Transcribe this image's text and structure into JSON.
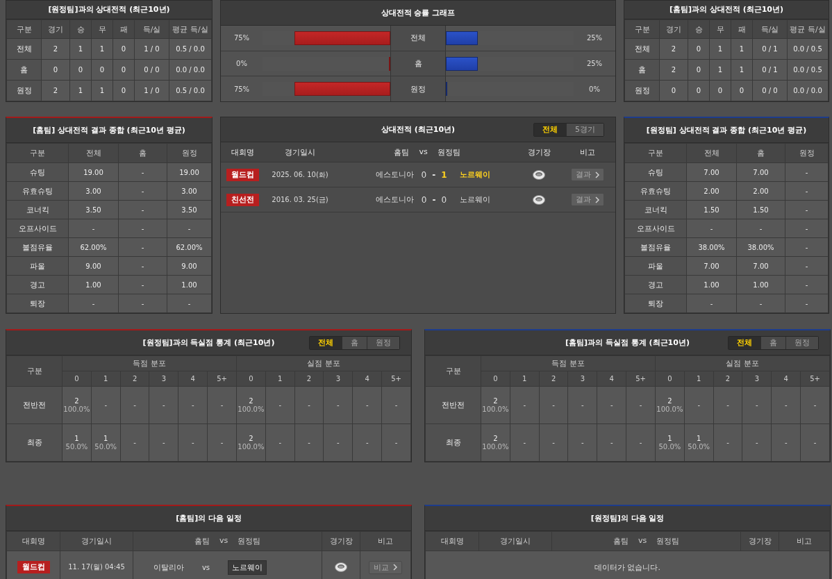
{
  "record_left": {
    "title": "[원정팀]과의 상대전적 (최근10년)",
    "columns": [
      "구분",
      "경기",
      "승",
      "무",
      "패",
      "득/실",
      "평균 득/실"
    ],
    "rows": [
      [
        "전체",
        "2",
        "1",
        "1",
        "0",
        "1 / 0",
        "0.5 / 0.0"
      ],
      [
        "홈",
        "0",
        "0",
        "0",
        "0",
        "0 / 0",
        "0.0 / 0.0"
      ],
      [
        "원정",
        "2",
        "1",
        "1",
        "0",
        "1 / 0",
        "0.5 / 0.0"
      ]
    ]
  },
  "win_graph": {
    "title": "상대전적 승률 그래프",
    "rows": [
      {
        "label": "전체",
        "home": {
          "reading": "75%",
          "level": 0.75
        },
        "away": {
          "reading": "25%",
          "level": 0.25
        }
      },
      {
        "label": "홈",
        "home": {
          "reading": "0%",
          "level": 0
        },
        "away": {
          "reading": "25%",
          "level": 0.25
        }
      },
      {
        "label": "원정",
        "home": {
          "reading": "75%",
          "level": 0.75
        },
        "away": {
          "reading": "0%",
          "level": 0
        }
      }
    ]
  },
  "record_right": {
    "title": "[홈팀]과의 상대전적 (최근10년)",
    "columns": [
      "구분",
      "경기",
      "승",
      "무",
      "패",
      "득/실",
      "평균 득/실"
    ],
    "rows": [
      [
        "전체",
        "2",
        "0",
        "1",
        "1",
        "0 / 1",
        "0.0 / 0.5"
      ],
      [
        "홈",
        "2",
        "0",
        "1",
        "1",
        "0 / 1",
        "0.0 / 0.5"
      ],
      [
        "원정",
        "0",
        "0",
        "0",
        "0",
        "0 / 0",
        "0.0 / 0.0"
      ]
    ]
  },
  "summary_home": {
    "home_side": true,
    "title": "[홈팀] 상대전적 결과 종합 (최근10년 평균)",
    "columns": [
      "구분",
      "전체",
      "홈",
      "원정"
    ],
    "rows": [
      [
        "슈팅",
        "19.00",
        "-",
        "19.00"
      ],
      [
        "유효슈팅",
        "3.00",
        "-",
        "3.00"
      ],
      [
        "코너킥",
        "3.50",
        "-",
        "3.50"
      ],
      [
        "오프사이드",
        "-",
        "-",
        "-"
      ],
      [
        "볼점유율",
        "62.00%",
        "-",
        "62.00%"
      ],
      [
        "파울",
        "9.00",
        "-",
        "9.00"
      ],
      [
        "경고",
        "1.00",
        "-",
        "1.00"
      ],
      [
        "퇴장",
        "-",
        "-",
        "-"
      ]
    ]
  },
  "head_to_head": {
    "title": "상대전적 (최근10년)",
    "tabs": [
      {
        "label": "전체",
        "selected": true
      },
      {
        "label": "5경기",
        "selected": false
      }
    ],
    "columns": [
      "대회명",
      "경기일시",
      "홈팀",
      "vs",
      "원정팀",
      "경기장",
      "비고"
    ],
    "rows": [
      {
        "competition": "월드컵",
        "color": "#b71f1f",
        "date": "2025. 06. 10(화)",
        "home": "에스토니아",
        "home_score": "0",
        "separator": "-",
        "away_score": "1",
        "away": "노르웨이",
        "home_won": false,
        "away_won": true,
        "button": "결과"
      },
      {
        "competition": "친선전",
        "color": "#b71f1f",
        "date": "2016. 03. 25(금)",
        "home": "에스토니아",
        "home_score": "0",
        "separator": "-",
        "away_score": "0",
        "away": "노르웨이",
        "home_won": false,
        "away_won": false,
        "button": "결과"
      }
    ]
  },
  "summary_away": {
    "home_side": false,
    "title": "[원정팀] 상대전적 결과 종합 (최근10년 평균)",
    "columns": [
      "구분",
      "전체",
      "홈",
      "원정"
    ],
    "rows": [
      [
        "슈팅",
        "7.00",
        "7.00",
        "-"
      ],
      [
        "유효슈팅",
        "2.00",
        "2.00",
        "-"
      ],
      [
        "코너킥",
        "1.50",
        "1.50",
        "-"
      ],
      [
        "오프사이드",
        "-",
        "-",
        "-"
      ],
      [
        "볼점유율",
        "38.00%",
        "38.00%",
        "-"
      ],
      [
        "파울",
        "7.00",
        "7.00",
        "-"
      ],
      [
        "경고",
        "1.00",
        "1.00",
        "-"
      ],
      [
        "퇴장",
        "-",
        "-",
        "-"
      ]
    ]
  },
  "goals_home": {
    "home_side": true,
    "title": "[원정팀]과의 득실점 통계 (최근10년)",
    "tabs": [
      {
        "label": "전체",
        "selected": true
      },
      {
        "label": "홈",
        "selected": false
      },
      {
        "label": "원정",
        "selected": false
      }
    ],
    "row_header": "구분",
    "groups": [
      {
        "label": "득점 분포",
        "columns": [
          "0",
          "1",
          "2",
          "3",
          "4",
          "5+"
        ]
      },
      {
        "label": "실점 분포",
        "columns": [
          "0",
          "1",
          "2",
          "3",
          "4",
          "5+"
        ]
      }
    ],
    "rows": [
      {
        "label": "전반전",
        "cells": [
          {
            "value": "2",
            "pct": "100.0%"
          },
          {
            "value": "-"
          },
          {
            "value": "-"
          },
          {
            "value": "-"
          },
          {
            "value": "-"
          },
          {
            "value": "-"
          },
          {
            "value": "2",
            "pct": "100.0%"
          },
          {
            "value": "-"
          },
          {
            "value": "-"
          },
          {
            "value": "-"
          },
          {
            "value": "-"
          },
          {
            "value": "-"
          }
        ]
      },
      {
        "label": "최종",
        "cells": [
          {
            "value": "1",
            "pct": "50.0%"
          },
          {
            "value": "1",
            "pct": "50.0%"
          },
          {
            "value": "-"
          },
          {
            "value": "-"
          },
          {
            "value": "-"
          },
          {
            "value": "-"
          },
          {
            "value": "2",
            "pct": "100.0%"
          },
          {
            "value": "-"
          },
          {
            "value": "-"
          },
          {
            "value": "-"
          },
          {
            "value": "-"
          },
          {
            "value": "-"
          }
        ]
      }
    ]
  },
  "goals_away": {
    "home_side": false,
    "title": "[홈팀]과의 득실점 통계 (최근10년)",
    "tabs": [
      {
        "label": "전체",
        "selected": true
      },
      {
        "label": "홈",
        "selected": false
      },
      {
        "label": "원정",
        "selected": false
      }
    ],
    "row_header": "구분",
    "groups": [
      {
        "label": "득점 분포",
        "columns": [
          "0",
          "1",
          "2",
          "3",
          "4",
          "5+"
        ]
      },
      {
        "label": "실점 분포",
        "columns": [
          "0",
          "1",
          "2",
          "3",
          "4",
          "5+"
        ]
      }
    ],
    "rows": [
      {
        "label": "전반전",
        "cells": [
          {
            "value": "2",
            "pct": "100.0%"
          },
          {
            "value": "-"
          },
          {
            "value": "-"
          },
          {
            "value": "-"
          },
          {
            "value": "-"
          },
          {
            "value": "-"
          },
          {
            "value": "2",
            "pct": "100.0%"
          },
          {
            "value": "-"
          },
          {
            "value": "-"
          },
          {
            "value": "-"
          },
          {
            "value": "-"
          },
          {
            "value": "-"
          }
        ]
      },
      {
        "label": "최종",
        "cells": [
          {
            "value": "2",
            "pct": "100.0%"
          },
          {
            "value": "-"
          },
          {
            "value": "-"
          },
          {
            "value": "-"
          },
          {
            "value": "-"
          },
          {
            "value": "-"
          },
          {
            "value": "1",
            "pct": "50.0%"
          },
          {
            "value": "1",
            "pct": "50.0%"
          },
          {
            "value": "-"
          },
          {
            "value": "-"
          },
          {
            "value": "-"
          },
          {
            "value": "-"
          }
        ]
      }
    ]
  },
  "next_home": {
    "home_side": true,
    "title": "[홈팀]의 다음 일정",
    "columns": [
      "대회명",
      "경기일시",
      "홈팀",
      "vs",
      "원정팀",
      "경기장",
      "비고"
    ],
    "rows": [
      {
        "competition": "월드컵",
        "color": "#b71f1f",
        "date": "11. 17(월) 04:45",
        "home": "이탈리아",
        "vs": "vs",
        "away": "노르웨이",
        "away_boxed": true,
        "button": "비교"
      }
    ]
  },
  "next_away": {
    "home_side": false,
    "title": "[원정팀]의 다음 일정",
    "columns": [
      "대회명",
      "경기일시",
      "홈팀",
      "vs",
      "원정팀",
      "경기장",
      "비고"
    ],
    "empty_message": "데이터가 없습니다."
  }
}
